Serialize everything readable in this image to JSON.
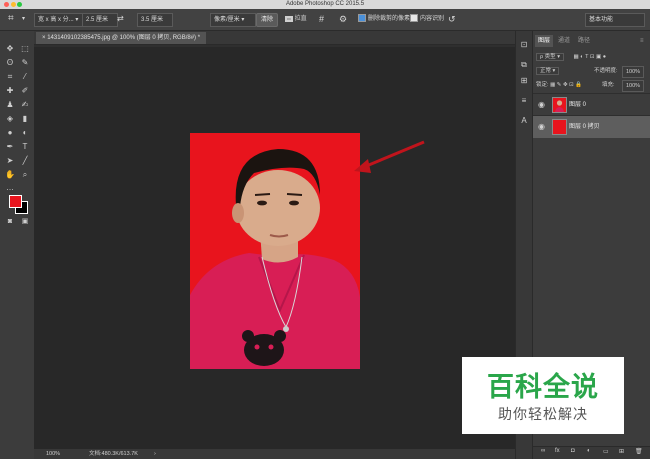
{
  "window": {
    "title": "Adobe Photoshop CC 2015.5"
  },
  "options_bar": {
    "ratio_select": "宽 x 高 x 分...",
    "width_value": "2.5 厘米",
    "height_value": "3.5 厘米",
    "resolution_select": "像素/厘米",
    "clear_button": "清除",
    "straighten_label": "拉直",
    "delete_cropped_label": "删除裁剪的像素",
    "delete_cropped_checked": true,
    "content_aware_label": "内容识别",
    "content_aware_checked": false,
    "workspace_select": "基本功能"
  },
  "document": {
    "tab_title": "1431409102385475.jpg @ 100% (图层 0 拷贝, RGB/8#) *",
    "zoom": "100%",
    "doc_size": "文档:480.3K/613.7K",
    "photo_background": "#e8141d",
    "shirt_color": "#d81e55"
  },
  "layers_panel": {
    "tabs": [
      "图层",
      "通道",
      "路径"
    ],
    "active_tab": "图层",
    "filter_label": "ρ 类型",
    "blend_mode": "正常",
    "opacity_label": "不透明度:",
    "opacity_value": "100%",
    "lock_label": "锁定:",
    "fill_label": "填充:",
    "fill_value": "100%",
    "layers": [
      {
        "name": "图层 0",
        "selected": false,
        "thumb": "photo"
      },
      {
        "name": "图层 0 拷贝",
        "selected": true,
        "thumb": "red"
      }
    ]
  },
  "watermark": {
    "title": "百科全说",
    "subtitle": "助你轻松解决",
    "title_color": "#2aa64a"
  }
}
